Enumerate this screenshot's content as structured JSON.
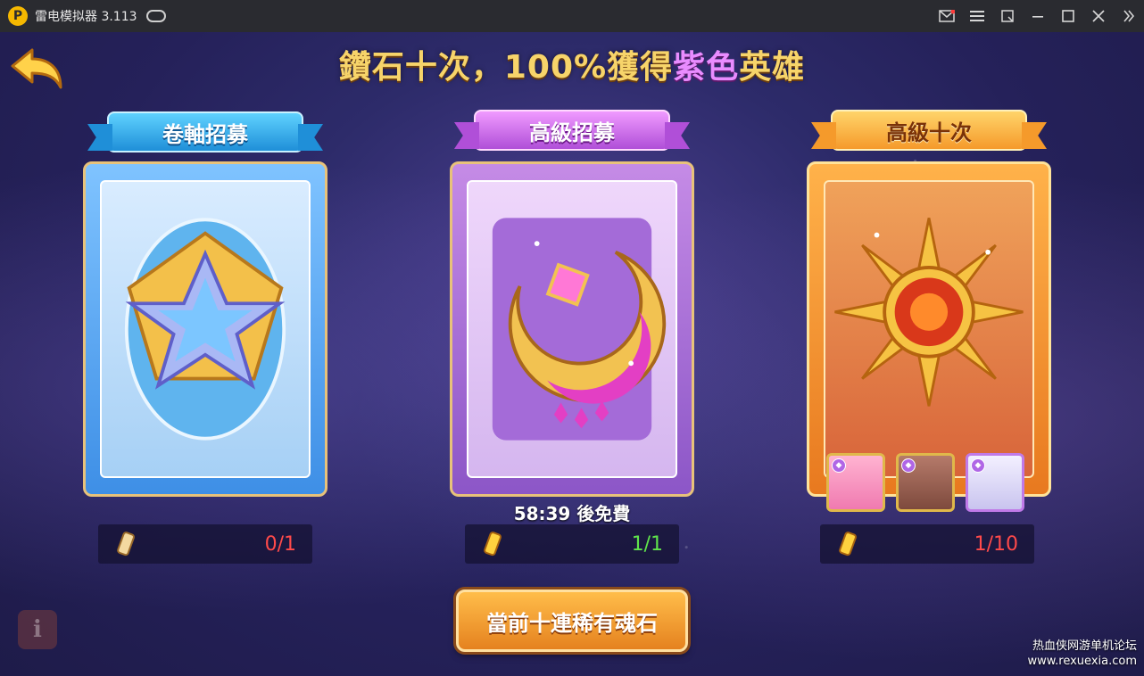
{
  "window": {
    "app_title": "雷电模拟器 3.113",
    "logo_glyph": "P"
  },
  "window_controls": [
    "mail-icon",
    "menu-icon",
    "restore-window-icon",
    "minimize-icon",
    "maximize-icon",
    "close-icon",
    "expand-icon"
  ],
  "game": {
    "headline_part1": "鑽石十次，100%獲得",
    "headline_purple": "紫色",
    "headline_part2": "英雄",
    "cards": [
      {
        "title": "卷軸招募",
        "cost": "0/1",
        "cost_color": "#ff4a4a"
      },
      {
        "title": "高級招募",
        "cost": "1/1",
        "cost_color": "#5fe34b"
      },
      {
        "title": "高級十次",
        "cost": "1/10",
        "cost_color": "#ff4a4a"
      }
    ],
    "timer_text": "58:39 後免費",
    "soul_stone_button": "當前十連稀有魂石",
    "info_glyph": "i"
  },
  "watermark": {
    "line1": "热血侠网游单机论坛",
    "line2": "www.rexuexia.com"
  },
  "colors": {
    "accent_gold": "#f7d46a",
    "accent_purple": "#e98cff"
  }
}
